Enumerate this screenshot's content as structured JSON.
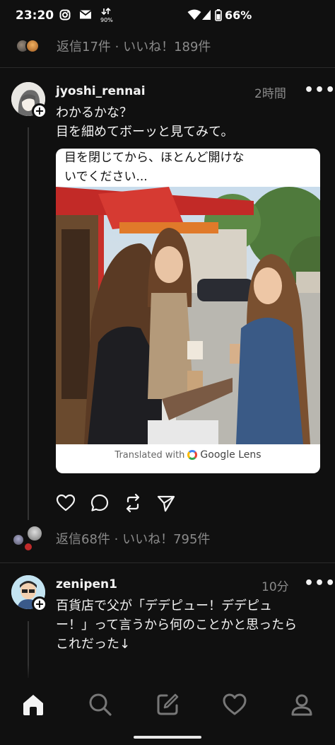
{
  "status_bar": {
    "time": "23:20",
    "battery": "66%",
    "data_badge": "90%",
    "icons": [
      "instagram-icon",
      "mail-icon",
      "data-usage-icon",
      "wifi-icon",
      "signal-icon",
      "battery-icon"
    ]
  },
  "top_summary": {
    "text": "返信17件 · いいね！189件"
  },
  "post1": {
    "username": "jyoshi_rennai",
    "time": "2時間",
    "more": "•••",
    "body_line1": "わかるかな？",
    "body_line2": "目を細めてボーッと見てみて。",
    "image_caption_line1": "目を閉じてから、ほとんど開けな",
    "image_caption_line2": "いでください...",
    "translated_prefix": "Translated with",
    "translated_brand": "Google Lens",
    "reply_summary": "返信68件 · いいね！795件"
  },
  "post2": {
    "username": "zenipen1",
    "time": "10分",
    "more": "•••",
    "body_line1": "百貨店で父が「デデピュー！デデピュ",
    "body_line2": "ー！」って言うから何のことかと思ったら",
    "body_line3": "これだった↓"
  },
  "nav": {
    "items": [
      "home-icon",
      "search-icon",
      "compose-icon",
      "activity-heart-icon",
      "profile-icon"
    ]
  },
  "colors": {
    "background": "#101010",
    "muted_text": "#8a8a8a",
    "primary_text": "#f3f3f3"
  }
}
